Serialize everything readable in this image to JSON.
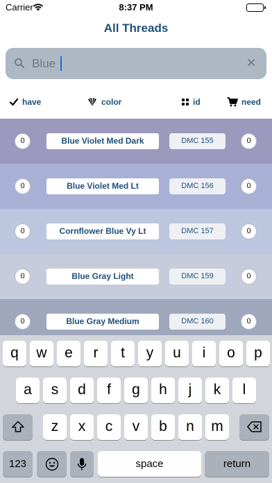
{
  "status_bar": {
    "carrier": "Carrier",
    "time": "8:37 PM",
    "battery_level": 1.0
  },
  "nav": {
    "title": "All Threads"
  },
  "search": {
    "value": "Blue",
    "placeholder": ""
  },
  "sort_bar": {
    "have_label": "have",
    "color_label": "color",
    "id_label": "id",
    "need_label": "need"
  },
  "threads": [
    {
      "have": "0",
      "name": "Blue Violet Med Dark",
      "id": "DMC 155",
      "need": "0",
      "color": "#9b99bd"
    },
    {
      "have": "0",
      "name": "Blue Violet Med Lt",
      "id": "DMC 156",
      "need": "0",
      "color": "#a8b0d6"
    },
    {
      "have": "0",
      "name": "Cornflower Blue Vy Lt",
      "id": "DMC 157",
      "need": "0",
      "color": "#bcc6df"
    },
    {
      "have": "0",
      "name": "Blue Gray Light",
      "id": "DMC 159",
      "need": "0",
      "color": "#c6ccdb"
    },
    {
      "have": "0",
      "name": "Blue Gray Medium",
      "id": "DMC 160",
      "need": "0",
      "color": "#9fa7bd"
    }
  ],
  "keyboard": {
    "row1": [
      "q",
      "w",
      "e",
      "r",
      "t",
      "y",
      "u",
      "i",
      "o",
      "p"
    ],
    "row2": [
      "a",
      "s",
      "d",
      "f",
      "g",
      "h",
      "j",
      "k",
      "l"
    ],
    "row3": [
      "z",
      "x",
      "c",
      "v",
      "b",
      "n",
      "m"
    ],
    "numbers_label": "123",
    "space_label": "space",
    "return_label": "return"
  }
}
